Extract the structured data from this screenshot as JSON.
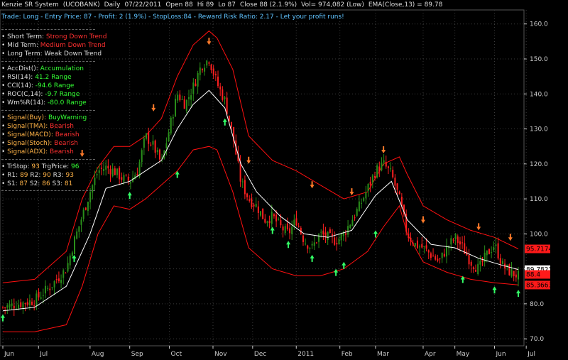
{
  "header": {
    "title": "Kenzie SR System",
    "symbol": "(UCOBANK)",
    "period": "Daily",
    "date": "07/22/2011",
    "open": "Open 88",
    "high": "Hi 89",
    "low": "Lo 87",
    "close": "Close 88 (2.1.9%)",
    "vol": "Vol= 974,082 (Low)",
    "ema": "EMA(Close,13) = 89.78"
  },
  "trade_line": "Trade: Long - Entry Price: 87 - Profit: 2 (1.9%) - StopLoss:84 - Reward Risk Ratio: 2.17 - Let your profit runs!",
  "panel": {
    "trend": [
      {
        "label": "Short Term:",
        "value": "Strong Down Trend",
        "color": "#ff3030"
      },
      {
        "label": "Mid Term:",
        "value": "Medium Down Trend",
        "color": "#ff3030"
      },
      {
        "label": "Long Term:",
        "value": "Weak Down Trend",
        "color": "#dddddd"
      }
    ],
    "indicators": [
      {
        "label": "AccDist():",
        "value": "Accumulation",
        "color": "#33ff33"
      },
      {
        "label": "RSI(14):",
        "value": "41.2 Range",
        "color": "#33ff33"
      },
      {
        "label": "CCI(14):",
        "value": "-94.6 Range",
        "color": "#33ff33"
      },
      {
        "label": "ROC(C,14):",
        "value": "-9.7 Range",
        "color": "#33ff33"
      },
      {
        "label": "Wm%R(14):",
        "value": "-80.0 Range",
        "color": "#33ff33"
      }
    ],
    "signals": [
      {
        "label": "Signal(Buy):",
        "value": "BuyWarning",
        "color": "#33ff33"
      },
      {
        "label": "Signal(TMA):",
        "value": "Bearish",
        "color": "#ff3030"
      },
      {
        "label": "Signal(MACD):",
        "value": "Bearish",
        "color": "#ff3030"
      },
      {
        "label": "Signal(Stoch):",
        "value": "Bearish",
        "color": "#ff3030"
      },
      {
        "label": "Signal(ADX):",
        "value": "Bearish",
        "color": "#ff3030"
      }
    ],
    "levels": {
      "tstop_label": "TrStop:",
      "tstop": "93",
      "trg_label": "TrgPrice:",
      "trg": "96",
      "r1_label": "R1:",
      "r1": "89",
      "r2_label": "R2:",
      "r2": "90",
      "r3_label": "R3:",
      "r3": "93",
      "s1_label": "S1:",
      "s1": "87",
      "s2_label": "S2:",
      "s2": "86",
      "s3_label": "S3:",
      "s3": "81"
    }
  },
  "colors": {
    "up": "#2a8f1a",
    "down": "#ff2020",
    "band": "#ff1010",
    "ema": "#ffffff",
    "grid": "#3a3a3a",
    "axis": "#cccccc",
    "buy_arrow": "#33ff66",
    "sell_arrow": "#ff7a2a"
  },
  "chart_data": {
    "type": "candlestick",
    "y_ticks": [
      "70.0",
      "80.0",
      "90.0",
      "100.0",
      "110.0",
      "120.0",
      "130.0",
      "140.0",
      "150.0",
      "160.0"
    ],
    "ylim": [
      68,
      164
    ],
    "x_ticks": [
      "Jun",
      "Jul",
      "Aug",
      "Sep",
      "Oct",
      "Nov",
      "Dec",
      "2011",
      "Feb",
      "Mar",
      "Apr",
      "May",
      "Jun",
      "Jul"
    ],
    "price_labels": [
      {
        "text": "89.7823",
        "value": 89.78,
        "bg": "#ffffff",
        "fg": "#000000"
      },
      {
        "text": "95.7174",
        "value": 95.7,
        "bg": "#ff1a1a",
        "fg": "#000000"
      },
      {
        "text": "88.4",
        "value": 88.4,
        "bg": "#ff1a1a",
        "fg": "#000000"
      },
      {
        "text": "85.3663",
        "value": 85.37,
        "bg": "#ff1a1a",
        "fg": "#000000"
      }
    ],
    "price_path": [
      [
        0,
        79
      ],
      [
        2,
        80
      ],
      [
        4,
        81
      ],
      [
        6,
        85
      ],
      [
        8,
        90
      ],
      [
        9,
        98
      ],
      [
        10,
        105
      ],
      [
        11,
        112
      ],
      [
        12,
        118
      ],
      [
        13,
        119
      ],
      [
        14,
        118
      ],
      [
        15,
        116
      ],
      [
        16,
        115
      ],
      [
        17,
        118
      ],
      [
        18,
        128
      ],
      [
        19,
        125
      ],
      [
        20,
        120
      ],
      [
        21,
        130
      ],
      [
        22,
        140
      ],
      [
        23,
        137
      ],
      [
        24,
        142
      ],
      [
        25,
        148
      ],
      [
        26,
        150
      ],
      [
        27,
        143
      ],
      [
        28,
        138
      ],
      [
        29,
        128
      ],
      [
        30,
        115
      ],
      [
        31,
        110
      ],
      [
        32,
        108
      ],
      [
        33,
        104
      ],
      [
        34,
        105
      ],
      [
        35,
        102
      ],
      [
        36,
        100
      ],
      [
        37,
        104
      ],
      [
        38,
        98
      ],
      [
        39,
        96
      ],
      [
        40,
        100
      ],
      [
        41,
        99
      ],
      [
        42,
        98
      ],
      [
        43,
        100
      ],
      [
        44,
        104
      ],
      [
        45,
        108
      ],
      [
        46,
        113
      ],
      [
        47,
        118
      ],
      [
        48,
        120
      ],
      [
        49,
        117
      ],
      [
        50,
        110
      ],
      [
        51,
        100
      ],
      [
        52,
        97
      ],
      [
        53,
        96
      ],
      [
        54,
        94
      ],
      [
        55,
        92
      ],
      [
        56,
        96
      ],
      [
        57,
        99
      ],
      [
        58,
        96
      ],
      [
        59,
        92
      ],
      [
        60,
        90
      ],
      [
        61,
        94
      ],
      [
        62,
        97
      ],
      [
        63,
        91
      ],
      [
        64,
        89
      ],
      [
        65,
        88
      ]
    ],
    "ema_path": [
      [
        0,
        78
      ],
      [
        4,
        79
      ],
      [
        8,
        85
      ],
      [
        11,
        100
      ],
      [
        13,
        113
      ],
      [
        16,
        115
      ],
      [
        18,
        118
      ],
      [
        20,
        121
      ],
      [
        22,
        130
      ],
      [
        24,
        137
      ],
      [
        26,
        141
      ],
      [
        28,
        136
      ],
      [
        30,
        120
      ],
      [
        32,
        112
      ],
      [
        35,
        105
      ],
      [
        38,
        100
      ],
      [
        41,
        99
      ],
      [
        44,
        101
      ],
      [
        47,
        111
      ],
      [
        49,
        115
      ],
      [
        51,
        104
      ],
      [
        54,
        97
      ],
      [
        57,
        96
      ],
      [
        60,
        93
      ],
      [
        63,
        91
      ],
      [
        65,
        89.8
      ]
    ],
    "upper_band": [
      [
        0,
        86
      ],
      [
        4,
        87
      ],
      [
        8,
        95
      ],
      [
        10,
        110
      ],
      [
        12,
        119
      ],
      [
        14,
        125
      ],
      [
        16,
        125
      ],
      [
        18,
        128
      ],
      [
        20,
        133
      ],
      [
        22,
        145
      ],
      [
        24,
        154
      ],
      [
        26,
        158
      ],
      [
        27,
        156
      ],
      [
        29,
        147
      ],
      [
        31,
        128
      ],
      [
        34,
        121
      ],
      [
        37,
        118
      ],
      [
        40,
        114
      ],
      [
        43,
        110
      ],
      [
        46,
        112
      ],
      [
        48,
        120
      ],
      [
        50,
        122
      ],
      [
        51,
        117
      ],
      [
        53,
        108
      ],
      [
        56,
        104
      ],
      [
        59,
        101
      ],
      [
        62,
        99
      ],
      [
        65,
        95.7
      ]
    ],
    "lower_band": [
      [
        0,
        72
      ],
      [
        4,
        72
      ],
      [
        8,
        74
      ],
      [
        10,
        85
      ],
      [
        12,
        100
      ],
      [
        14,
        108
      ],
      [
        16,
        107
      ],
      [
        18,
        110
      ],
      [
        20,
        114
      ],
      [
        22,
        118
      ],
      [
        24,
        124
      ],
      [
        26,
        125
      ],
      [
        27,
        124
      ],
      [
        29,
        112
      ],
      [
        31,
        96
      ],
      [
        34,
        90
      ],
      [
        37,
        88
      ],
      [
        40,
        88
      ],
      [
        43,
        90
      ],
      [
        46,
        95
      ],
      [
        48,
        102
      ],
      [
        50,
        108
      ],
      [
        51,
        100
      ],
      [
        53,
        92
      ],
      [
        56,
        89
      ],
      [
        59,
        87
      ],
      [
        62,
        86
      ],
      [
        65,
        85.4
      ]
    ],
    "buy_signals": [
      [
        0,
        77
      ],
      [
        9,
        94
      ],
      [
        16,
        112
      ],
      [
        22,
        118
      ],
      [
        28,
        133
      ],
      [
        34,
        102
      ],
      [
        36,
        98
      ],
      [
        39,
        94
      ],
      [
        42,
        90
      ],
      [
        43,
        92
      ],
      [
        47,
        101
      ],
      [
        58,
        88
      ],
      [
        62,
        85
      ],
      [
        65,
        84
      ]
    ],
    "sell_signals": [
      [
        10,
        122
      ],
      [
        19,
        135
      ],
      [
        26,
        154
      ],
      [
        31,
        120
      ],
      [
        39,
        113
      ],
      [
        44,
        111
      ],
      [
        48,
        123
      ],
      [
        53,
        103
      ],
      [
        60,
        101
      ],
      [
        64,
        98
      ]
    ]
  }
}
